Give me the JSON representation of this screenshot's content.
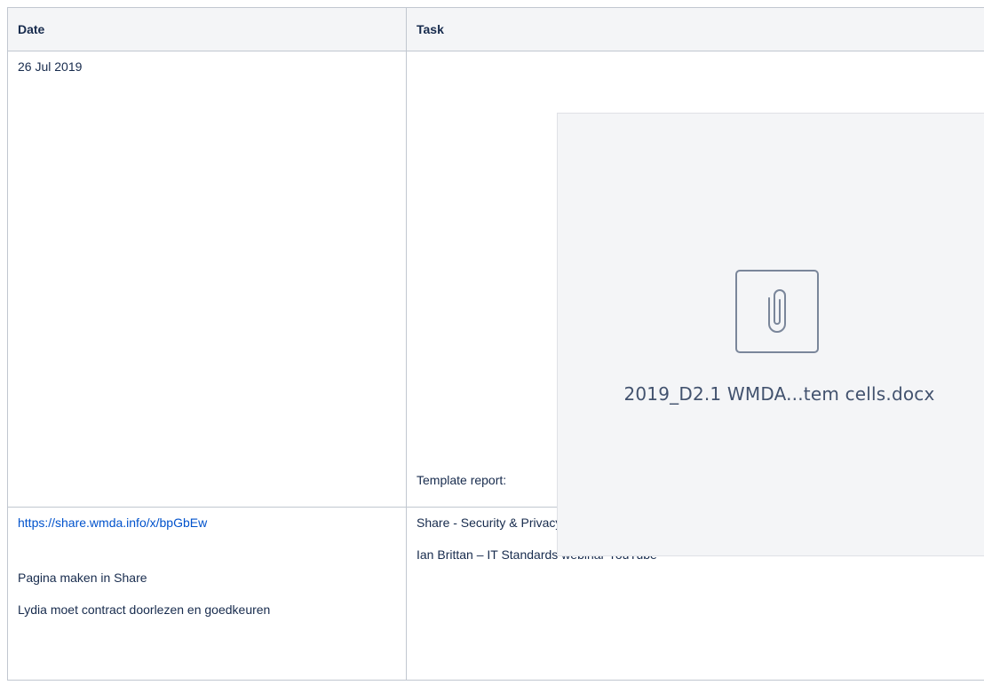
{
  "table": {
    "headers": {
      "date": "Date",
      "task": "Task"
    },
    "rows": [
      {
        "date": "26 Jul 2019",
        "task_label": "Template report:",
        "attachment": {
          "filename": "2019_D2.1 WMDA...tem cells.docx",
          "icon": "paperclip-icon"
        }
      },
      {
        "date_lines": [
          "https://share.wmda.info/x/bpGbEw",
          "Pagina maken in Share",
          "Lydia moet contract doorlezen en goedkeuren"
        ],
        "task_lines": [
          "Share - Security & Privacy Information",
          "Ian Brittan – IT Standards webinar YouTube"
        ]
      }
    ]
  },
  "colors": {
    "link": "#0052cc",
    "header_bg": "#f4f5f7",
    "border": "#c1c7d0",
    "attachment_bg": "#f4f5f7"
  }
}
